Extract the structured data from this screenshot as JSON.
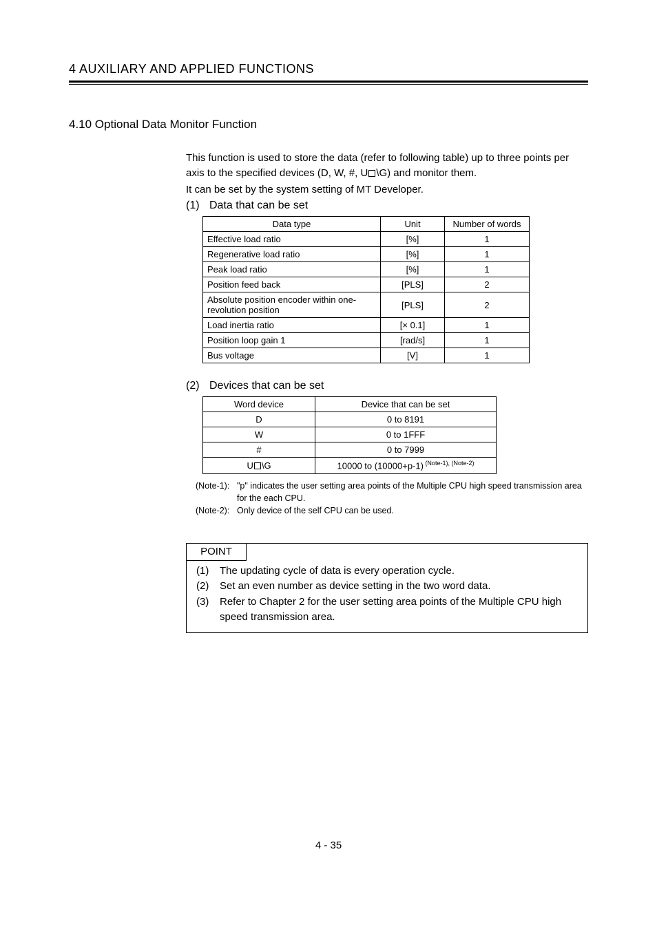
{
  "chapter_header": "4   AUXILIARY AND APPLIED FUNCTIONS",
  "section_title": "4.10 Optional Data Monitor Function",
  "intro": {
    "l1_pre": "This function is used to store the data (refer to following table) up to three points per axis to the specified devices (D, W, #, U",
    "l1_post": "\\G) and monitor them.",
    "l2": "It can be set by the system setting of MT Developer."
  },
  "sub1": {
    "num": "(1)",
    "title": "Data that can be set"
  },
  "t1": {
    "h1": "Data type",
    "h2": "Unit",
    "h3": "Number of words",
    "rows": [
      {
        "c1": "Effective load ratio",
        "c2": "[%]",
        "c3": "1"
      },
      {
        "c1": "Regenerative load ratio",
        "c2": "[%]",
        "c3": "1"
      },
      {
        "c1": "Peak load ratio",
        "c2": "[%]",
        "c3": "1"
      },
      {
        "c1": "Position feed back",
        "c2": "[PLS]",
        "c3": "2"
      },
      {
        "c1": "Absolute position encoder within one-revolution position",
        "c2": "[PLS]",
        "c3": "2"
      },
      {
        "c1": "Load inertia ratio",
        "c2": "[× 0.1]",
        "c3": "1"
      },
      {
        "c1": "Position loop gain 1",
        "c2": "[rad/s]",
        "c3": "1"
      },
      {
        "c1": "Bus voltage",
        "c2": "[V]",
        "c3": "1"
      }
    ]
  },
  "sub2": {
    "num": "(2)",
    "title": "Devices that can be set"
  },
  "t2": {
    "h1": "Word device",
    "h2": "Device that can be set",
    "rows": [
      {
        "c1": "D",
        "c2": "0 to 8191"
      },
      {
        "c1": "W",
        "c2": "0 to 1FFF"
      },
      {
        "c1": "#",
        "c2": "0 to 7999"
      }
    ],
    "last": {
      "c1_pre": "U",
      "c1_post": "\\G",
      "c2": "10000 to (10000+p-1)",
      "c2_sup": " (Note-1), (Note-2)"
    }
  },
  "notes": {
    "n1_lbl": "(Note-1):",
    "n1_txt": "\"p\" indicates the user setting area points of the Multiple CPU high speed transmission area for the each CPU.",
    "n2_lbl": "(Note-2):",
    "n2_txt": "Only device of the self CPU can be used."
  },
  "point": {
    "tab": "POINT",
    "rows": [
      {
        "n": "(1)",
        "t": "The updating cycle of data is every operation cycle."
      },
      {
        "n": "(2)",
        "t": "Set an even number as device setting in the two word data."
      },
      {
        "n": "(3)",
        "t": "Refer to Chapter 2 for the user setting area points of the Multiple CPU high speed transmission area."
      }
    ]
  },
  "footer": "4 - 35"
}
